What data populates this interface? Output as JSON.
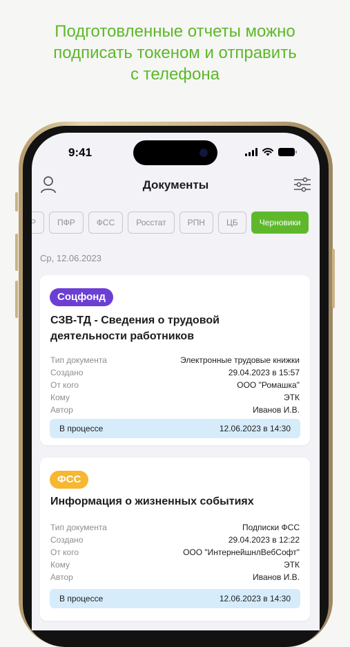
{
  "promo": {
    "line1": "Подготовленные отчеты можно",
    "line2": "подписать токеном и отправить",
    "line3": "с телефона"
  },
  "status_bar": {
    "time": "9:41"
  },
  "nav": {
    "title": "Документы",
    "profile_icon": "user-icon",
    "filter_icon": "sliders-icon"
  },
  "filters": [
    "Р",
    "ПФР",
    "ФСС",
    "Росстат",
    "РПН",
    "ЦБ",
    "Черновики"
  ],
  "selected_filter": "Черновики",
  "date_header": "Ср, 12.06.2023",
  "documents": [
    {
      "tag": "Соцфонд",
      "tag_color": "#6c3fd4",
      "title_line1": "СЗВ-ТД - Сведения о трудовой",
      "title_line2": "деятельности работников",
      "fields": [
        {
          "key": "Тип документа",
          "value": "Электронные трудовые книжки"
        },
        {
          "key": "Создано",
          "value": "29.04.2023 в 15:57"
        },
        {
          "key": "От кого",
          "value": "ООО \"Ромашка\""
        },
        {
          "key": "Кому",
          "value": "ЭТК"
        },
        {
          "key": "Автор",
          "value": "Иванов И.В."
        }
      ],
      "status": "В процессе",
      "status_date": "12.06.2023 в 14:30"
    },
    {
      "tag": "ФСС",
      "tag_color": "#f7b731",
      "title_line1": "Информация о жизненных событиях",
      "fields": [
        {
          "key": "Тип документа",
          "value": "Подписки ФСС"
        },
        {
          "key": "Создано",
          "value": "29.04.2023 в 12:22"
        },
        {
          "key": "От кого",
          "value": "ООО \"ИнтернейшнлВебСофт\""
        },
        {
          "key": "Кому",
          "value": "ЭТК"
        },
        {
          "key": "Автор",
          "value": "Иванов И.В."
        }
      ],
      "status": "В процессе",
      "status_date": "12.06.2023 в 14:30"
    }
  ],
  "colors": {
    "accent_green": "#5fb82c",
    "status_bg": "#d7ecfb"
  }
}
